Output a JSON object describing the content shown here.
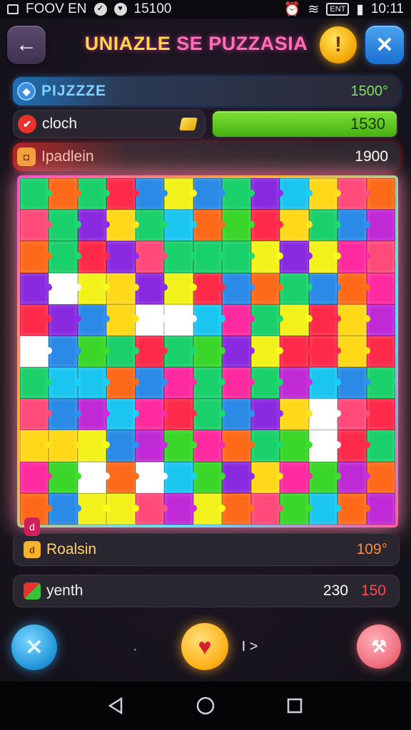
{
  "status_bar": {
    "left_text": "FOOV EN",
    "number": "15100",
    "battery_label": "ENT",
    "time": "10:11"
  },
  "header": {
    "title_part1": "UNIAZLE",
    "title_part2": "SE PUZZASIA",
    "alert_symbol": "!"
  },
  "stats": [
    {
      "label": "PIJZZZE",
      "value": "1500°",
      "icon": "puzzle-icon"
    },
    {
      "label": "cloch",
      "value": "1530",
      "icon": "clock-icon"
    },
    {
      "label": "Ipadlein",
      "value": "1900",
      "icon": "pad-icon"
    }
  ],
  "board": {
    "columns": 13,
    "rows": 11,
    "corner_badge": "d",
    "palette": [
      "#ff2a4a",
      "#ff6a1a",
      "#ffd81a",
      "#f2f21a",
      "#3ad62a",
      "#1ad06a",
      "#1ac6f0",
      "#2a8ae6",
      "#8a2ae0",
      "#c02ad6",
      "#ff2aa0",
      "#ff4a7a",
      "#ffffff"
    ]
  },
  "bottom_rows": [
    {
      "label": "Roalsin",
      "value": "109°",
      "icon": "reload-icon"
    },
    {
      "label": "yenth",
      "value1": "230",
      "value2": "150",
      "icon": "chart-icon"
    }
  ],
  "controls": {
    "close_symbol": "✕",
    "heart_symbol": "♥",
    "next_symbol": "I >",
    "tool_symbol": "⚒"
  },
  "colors": {
    "accent_blue": "#1e93d8",
    "accent_gold": "#ffb21a",
    "accent_pink": "#ff4fd0",
    "progress_green": "#45b012"
  }
}
